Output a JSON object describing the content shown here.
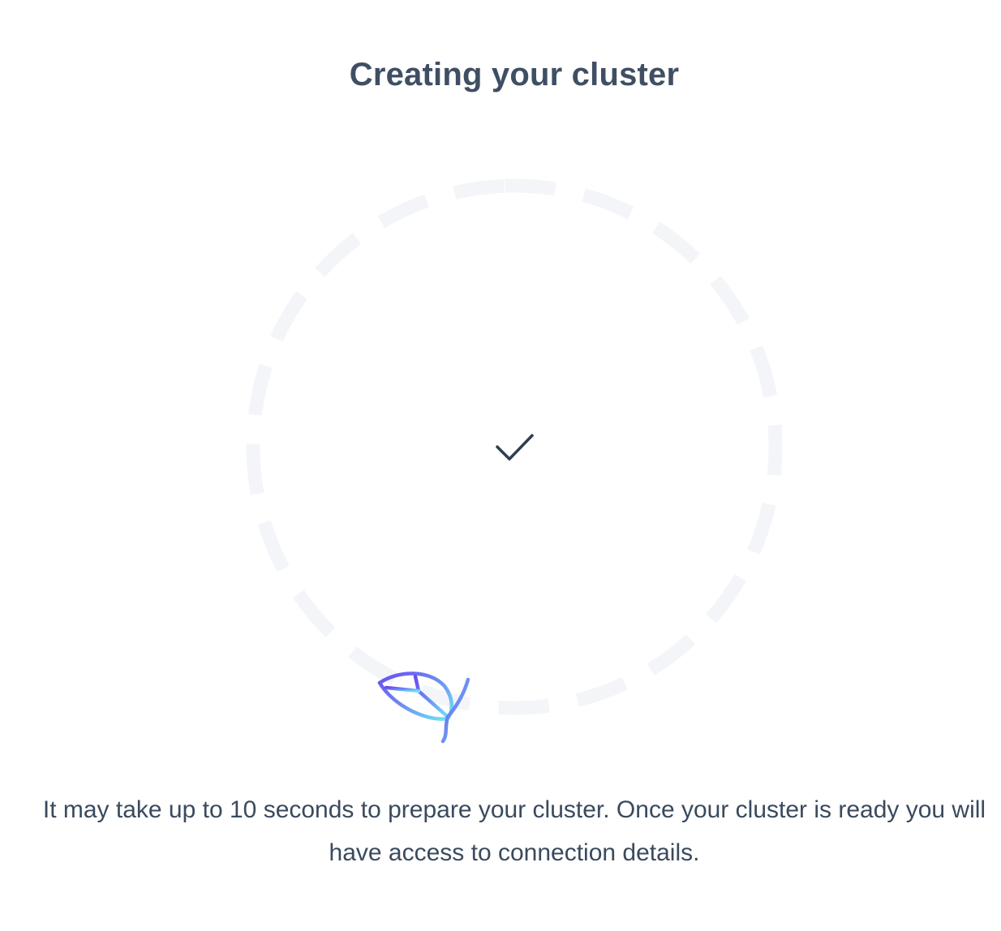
{
  "header": {
    "title": "Creating your cluster"
  },
  "progress": {
    "status": "complete",
    "status_icon": "checkmark-icon",
    "mascot_icon": "leaf-icon"
  },
  "message": {
    "text": "It may take up to 10 seconds to prepare your cluster. Once your cluster is ready you will have access to connection details."
  },
  "colors": {
    "title": "#3f4f63",
    "text": "#3a4a5e",
    "ring": "#f3f5f9",
    "check": "#2f3d50",
    "leaf_gradient_start": "#6a4cf0",
    "leaf_gradient_end": "#6ee7f2"
  }
}
